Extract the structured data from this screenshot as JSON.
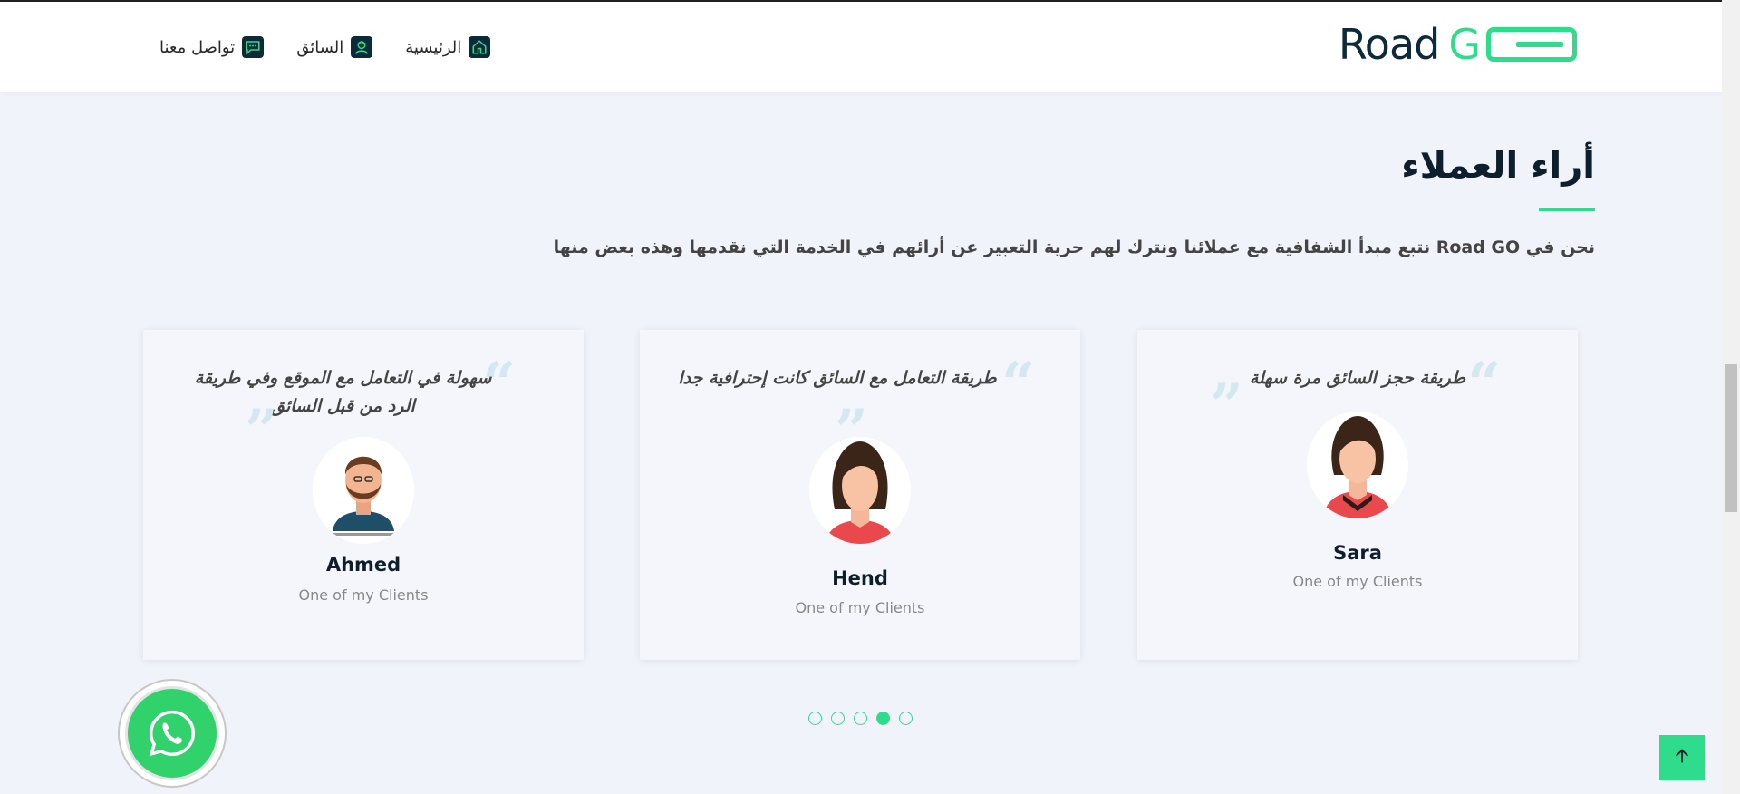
{
  "brand": {
    "logo_text_road": "Road",
    "logo_text_go": "G"
  },
  "nav": {
    "items": [
      {
        "label": "الرئيسية",
        "icon": "home-icon"
      },
      {
        "label": "السائق",
        "icon": "driver-icon"
      },
      {
        "label": "تواصل معنا",
        "icon": "chat-icon"
      }
    ]
  },
  "section": {
    "title": "أراء العملاء",
    "description": "نحن في Road GO نتبع مبدأ الشفافية مع عملائنا ونترك لهم حرية التعبير عن أرائهم في الخدمة التي نقدمها وهذه بعض منها"
  },
  "testimonials": [
    {
      "quote": "طريقة حجز السائق مرة سهلة",
      "name": "Sara",
      "role": "One of my Clients",
      "avatar": "female-avatar-icon"
    },
    {
      "quote": "طريقة التعامل مع السائق كانت إحترافية جدا",
      "name": "Hend",
      "role": "One of my Clients",
      "avatar": "female-avatar-icon"
    },
    {
      "quote": "سهولة في التعامل مع الموقع وفي طريقة الرد من قبل السائق",
      "name": "Ahmed",
      "role": "One of my Clients",
      "avatar": "male-avatar-icon"
    }
  ],
  "carousel": {
    "total_dots": 5,
    "active_index": 3
  },
  "colors": {
    "accent": "#2fdc8c",
    "dark": "#0d2a3a",
    "whatsapp": "#31d16b"
  },
  "icons": {
    "whatsapp": "whatsapp-phone-icon",
    "scroll_top": "arrow-up-icon"
  }
}
